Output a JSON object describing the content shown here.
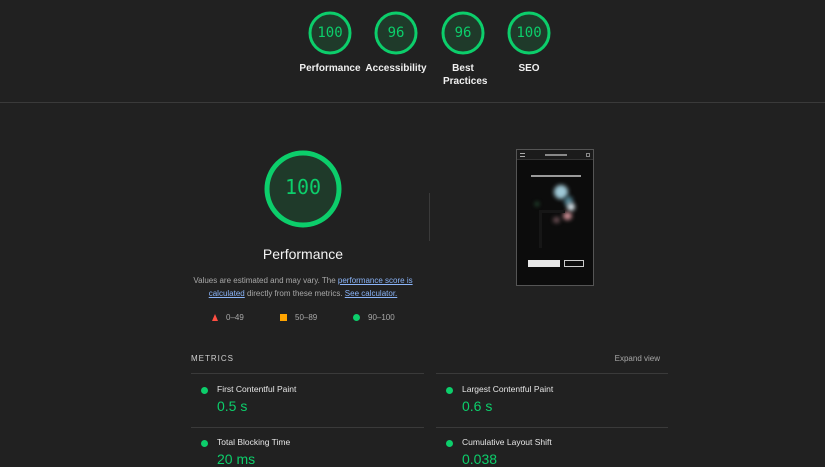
{
  "summary": {
    "categories": [
      {
        "score": "100",
        "label": "Performance"
      },
      {
        "score": "96",
        "label": "Accessibility"
      },
      {
        "score": "96",
        "label": "Best Practices"
      },
      {
        "score": "100",
        "label": "SEO"
      }
    ]
  },
  "performance": {
    "score": "100",
    "title": "Performance",
    "desc_pre": "Values are estimated and may vary. The ",
    "desc_link": "performance score is calculated",
    "desc_mid": " directly from these metrics. ",
    "desc_calc": "See calculator."
  },
  "legend": {
    "fail": "0–49",
    "average": "50–89",
    "pass": "90–100"
  },
  "metrics": {
    "heading": "METRICS",
    "expand_label": "Expand view",
    "items": [
      {
        "name": "First Contentful Paint",
        "value": "0.5 s"
      },
      {
        "name": "Largest Contentful Paint",
        "value": "0.6 s"
      },
      {
        "name": "Total Blocking Time",
        "value": "20 ms"
      },
      {
        "name": "Cumulative Layout Shift",
        "value": "0.038"
      }
    ]
  },
  "colors": {
    "pass": "#0cce6b",
    "average": "#ffa400",
    "fail": "#ff4e42",
    "background": "#212121"
  }
}
